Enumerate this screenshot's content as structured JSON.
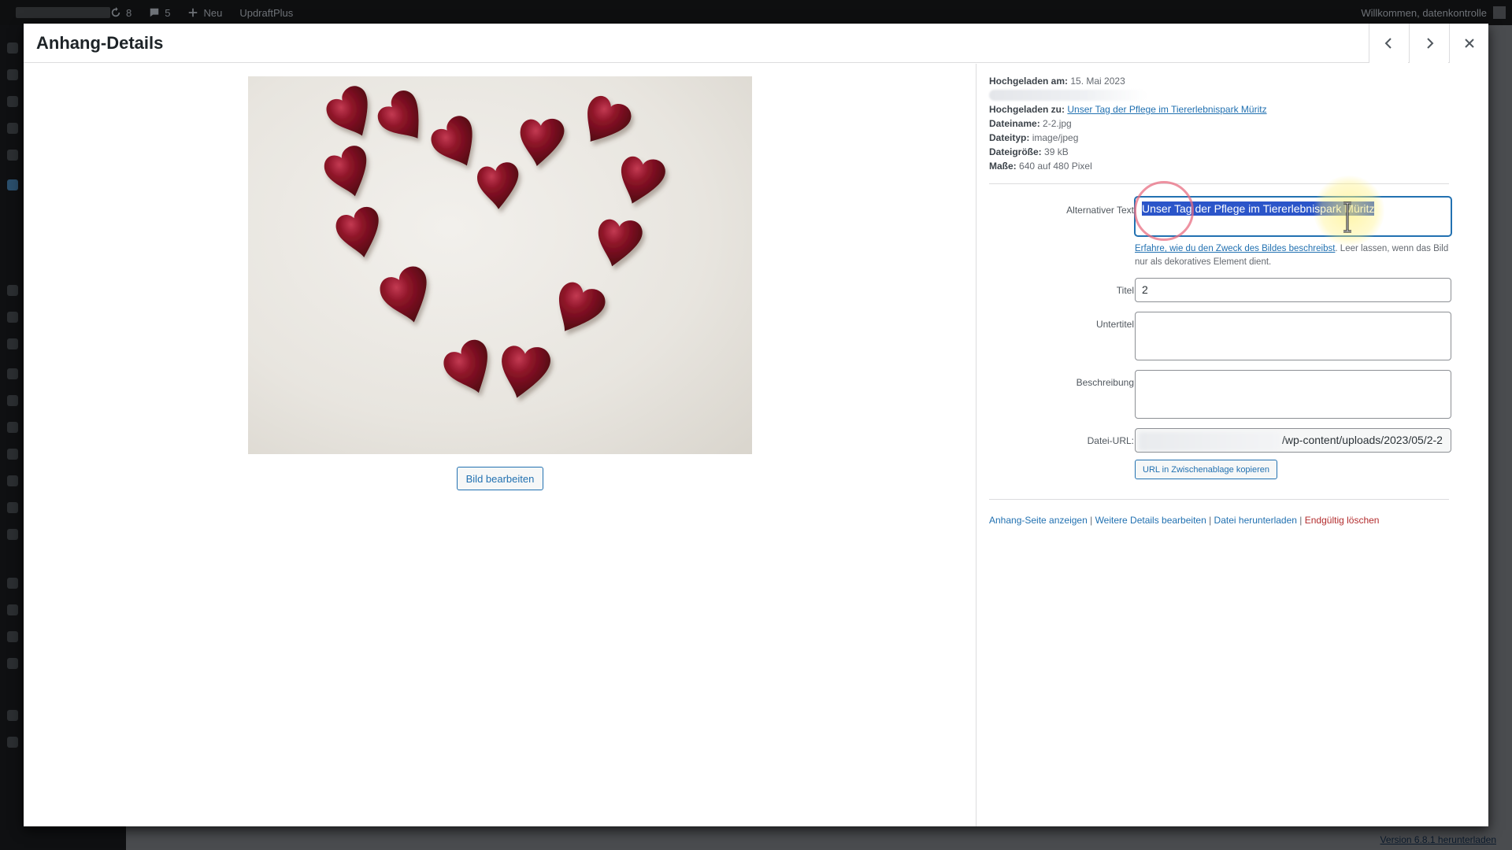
{
  "adminbar": {
    "updates_count": "8",
    "comments_count": "5",
    "new_label": "Neu",
    "plugin_label": "UpdraftPlus",
    "greeting": "Willkommen, datenkontrolle"
  },
  "footer": {
    "version_link": "Version 6.8.1 herunterladen"
  },
  "modal": {
    "title": "Anhang-Details",
    "prev_label": "Vorheriges",
    "next_label": "Nächstes",
    "close_label": "Schließen",
    "edit_image_label": "Bild bearbeiten",
    "image_alt": "Unser Tag der Pflege im Tiererlebnispark Müritz"
  },
  "details": {
    "uploaded_on_label": "Hochgeladen am:",
    "uploaded_on_value": "15. Mai 2023",
    "uploaded_to_label": "Hochgeladen zu:",
    "uploaded_to_value": "Unser Tag der Pflege im Tiererlebnispark Müritz",
    "filename_label": "Dateiname:",
    "filename_value": "2-2.jpg",
    "filetype_label": "Dateityp:",
    "filetype_value": "image/jpeg",
    "filesize_label": "Dateigröße:",
    "filesize_value": "39 kB",
    "dimensions_label": "Maße:",
    "dimensions_value": "640 auf 480 Pixel"
  },
  "form": {
    "alt_label": "Alternativer Text",
    "alt_value": "Unser Tag der Pflege im Tiererlebnispark Müritz",
    "help_link": "Erfahre, wie du den Zweck des Bildes beschreibst",
    "help_text": ". Leer lassen, wenn das Bild nur als dekoratives Element dient.",
    "title_label": "Titel",
    "title_value": "2",
    "caption_label": "Untertitel",
    "caption_value": "",
    "description_label": "Beschreibung",
    "description_value": "",
    "url_label": "Datei-URL:",
    "url_value": "/wp-content/uploads/2023/05/2-2",
    "copy_label": "URL in Zwischenablage kopieren"
  },
  "actions": {
    "view": "Anhang-Seite anzeigen",
    "edit_more": "Weitere Details bearbeiten",
    "download": "Datei herunterladen",
    "delete": "Endgültig löschen",
    "separator": " | "
  },
  "colors": {
    "accent": "#2271b1",
    "danger": "#b32d2e",
    "selection": "#2b55c9",
    "heart": "#7a0f1f"
  }
}
